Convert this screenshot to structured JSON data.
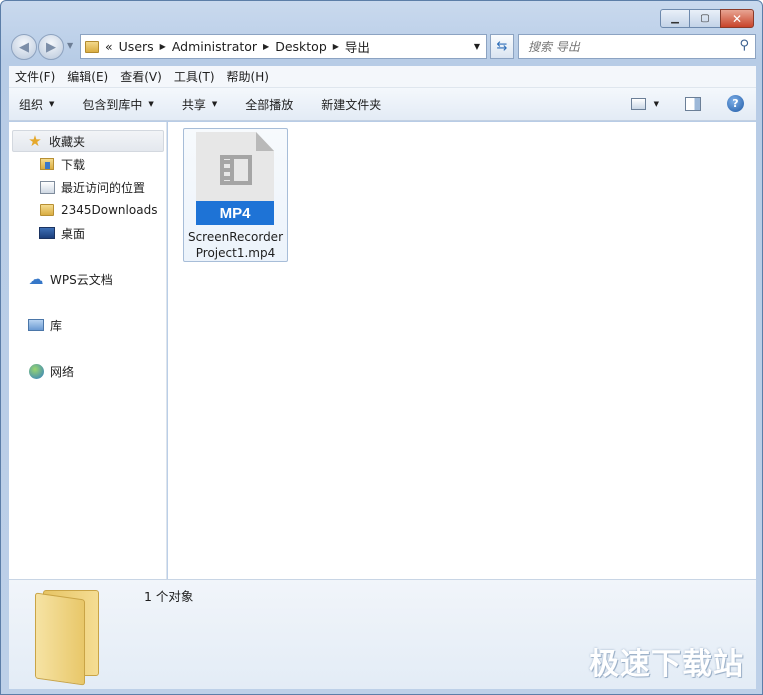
{
  "address": {
    "overflow": "«",
    "crumbs": [
      "Users",
      "Administrator",
      "Desktop",
      "导出"
    ]
  },
  "search": {
    "placeholder": "搜索 导出"
  },
  "menu": [
    "文件(F)",
    "编辑(E)",
    "查看(V)",
    "工具(T)",
    "帮助(H)"
  ],
  "commands": [
    "组织",
    "包含到库中",
    "共享",
    "全部播放",
    "新建文件夹"
  ],
  "nav": {
    "favorites": "收藏夹",
    "fav_items": [
      "下载",
      "最近访问的位置",
      "2345Downloads",
      "桌面"
    ],
    "wps": "WPS云文档",
    "library": "库",
    "network": "网络"
  },
  "file": {
    "badge": "MP4",
    "name_line1": "ScreenRecorder",
    "name_line2": "Project1.mp4"
  },
  "details": {
    "count": "1 个对象"
  },
  "watermark": "极速下载站",
  "icons": {
    "back": "back-arrow-icon",
    "forward": "forward-arrow-icon",
    "refresh": "refresh-icon",
    "search": "magnifier-icon",
    "help": "help-icon"
  }
}
